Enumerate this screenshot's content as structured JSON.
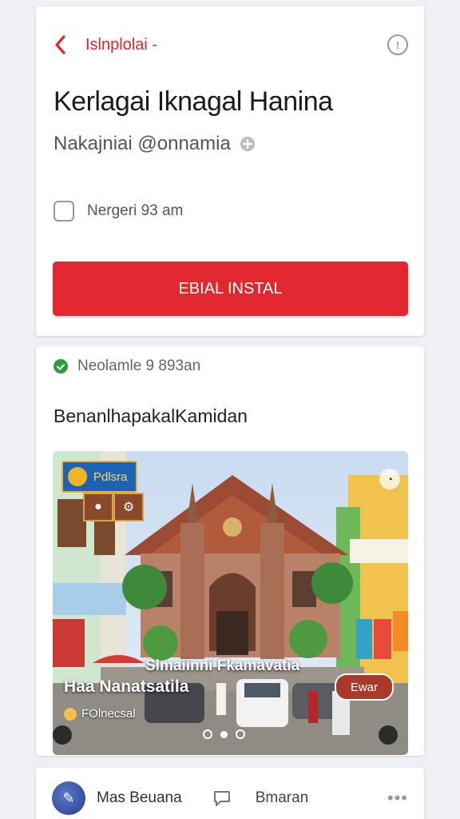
{
  "header": {
    "title": "Islnplolai -"
  },
  "post": {
    "title": "Kerlagai Iknagal Hanina",
    "subtitle": "Nakajniai @onnamia",
    "checkbox_label": "Nergeri 93 am",
    "primary_button": "EBIAL INSTAL"
  },
  "feed": {
    "status_text": "Neolamle 9 893an",
    "section_title": "BenanlhapakalKamidan",
    "photo": {
      "badge_label": "Pdlsra",
      "caption_line1": "Slmaiinni Fkamavatia",
      "caption_line2": "Haa Nanatsatila",
      "location": "FOlnecsal",
      "chip_label": "Ewar"
    }
  },
  "footer": {
    "author": "Mas Beuana",
    "comment_label": "Bmaran",
    "more_icon": "more-icon"
  },
  "colors": {
    "accent": "#e0282e",
    "status_green": "#2e9b3c"
  }
}
